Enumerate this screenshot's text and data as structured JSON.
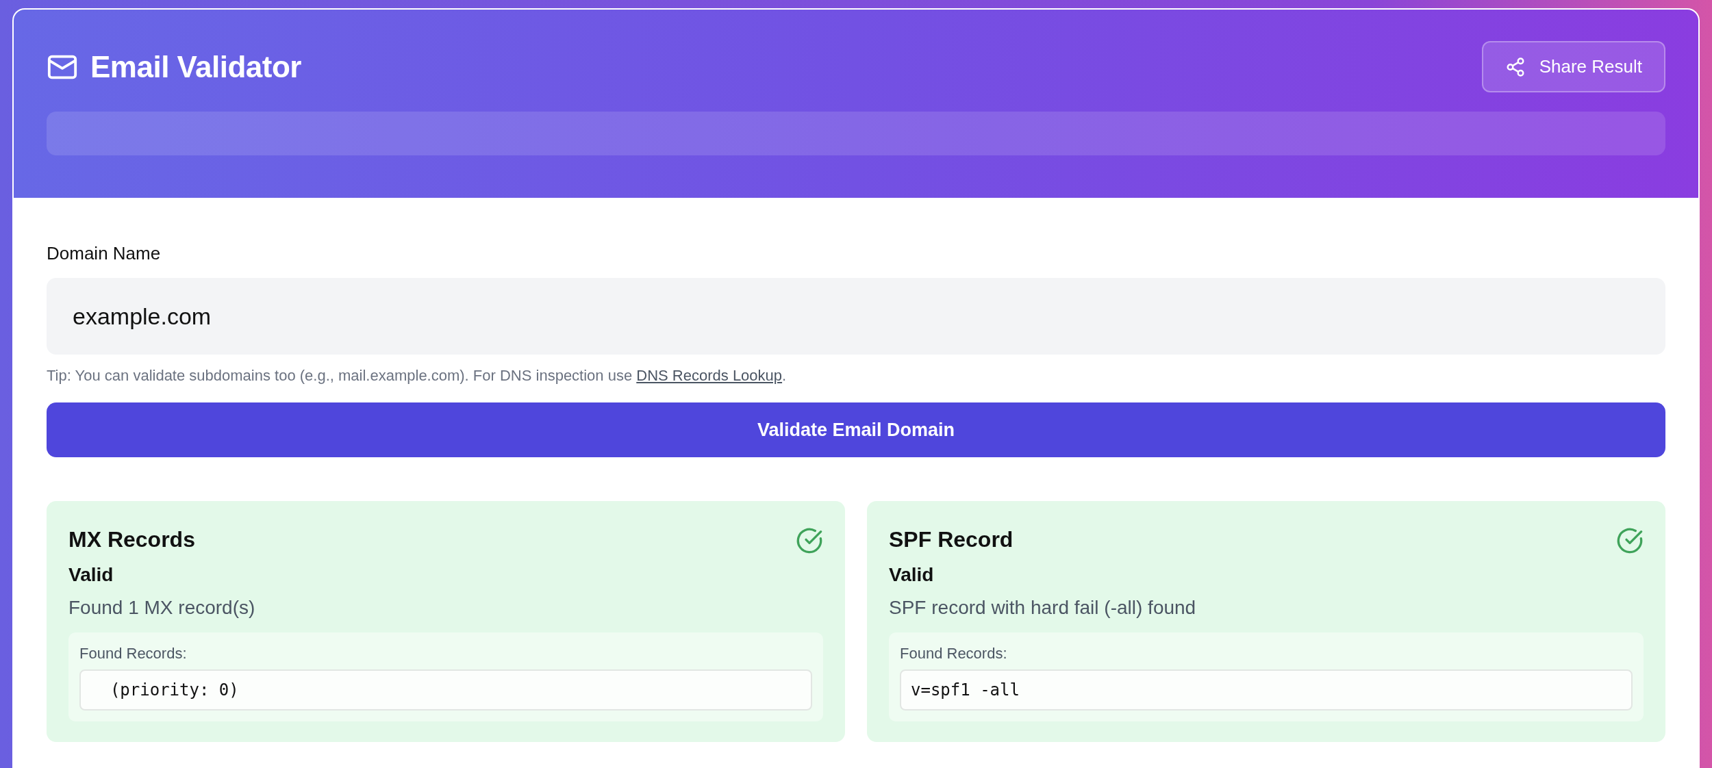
{
  "header": {
    "title": "Email Validator",
    "share_button": "Share Result"
  },
  "form": {
    "label": "Domain Name",
    "value": "example.com",
    "tip": "Tip: You can validate subdomains too (e.g., mail.example.com). For DNS inspection use ",
    "tip_link": "DNS Records Lookup",
    "tip_end": ".",
    "submit": "Validate Email Domain"
  },
  "results": [
    {
      "title": "MX Records",
      "kind": "valid",
      "status_label": "Valid",
      "message": "Found 1 MX record(s)",
      "records_label": "Found Records:",
      "records": [
        "  (priority: 0)"
      ]
    },
    {
      "title": "SPF Record",
      "kind": "valid",
      "status_label": "Valid",
      "message": "SPF record with hard fail (-all) found",
      "records_label": "Found Records:",
      "records": [
        "v=spf1 -all"
      ]
    }
  ]
}
